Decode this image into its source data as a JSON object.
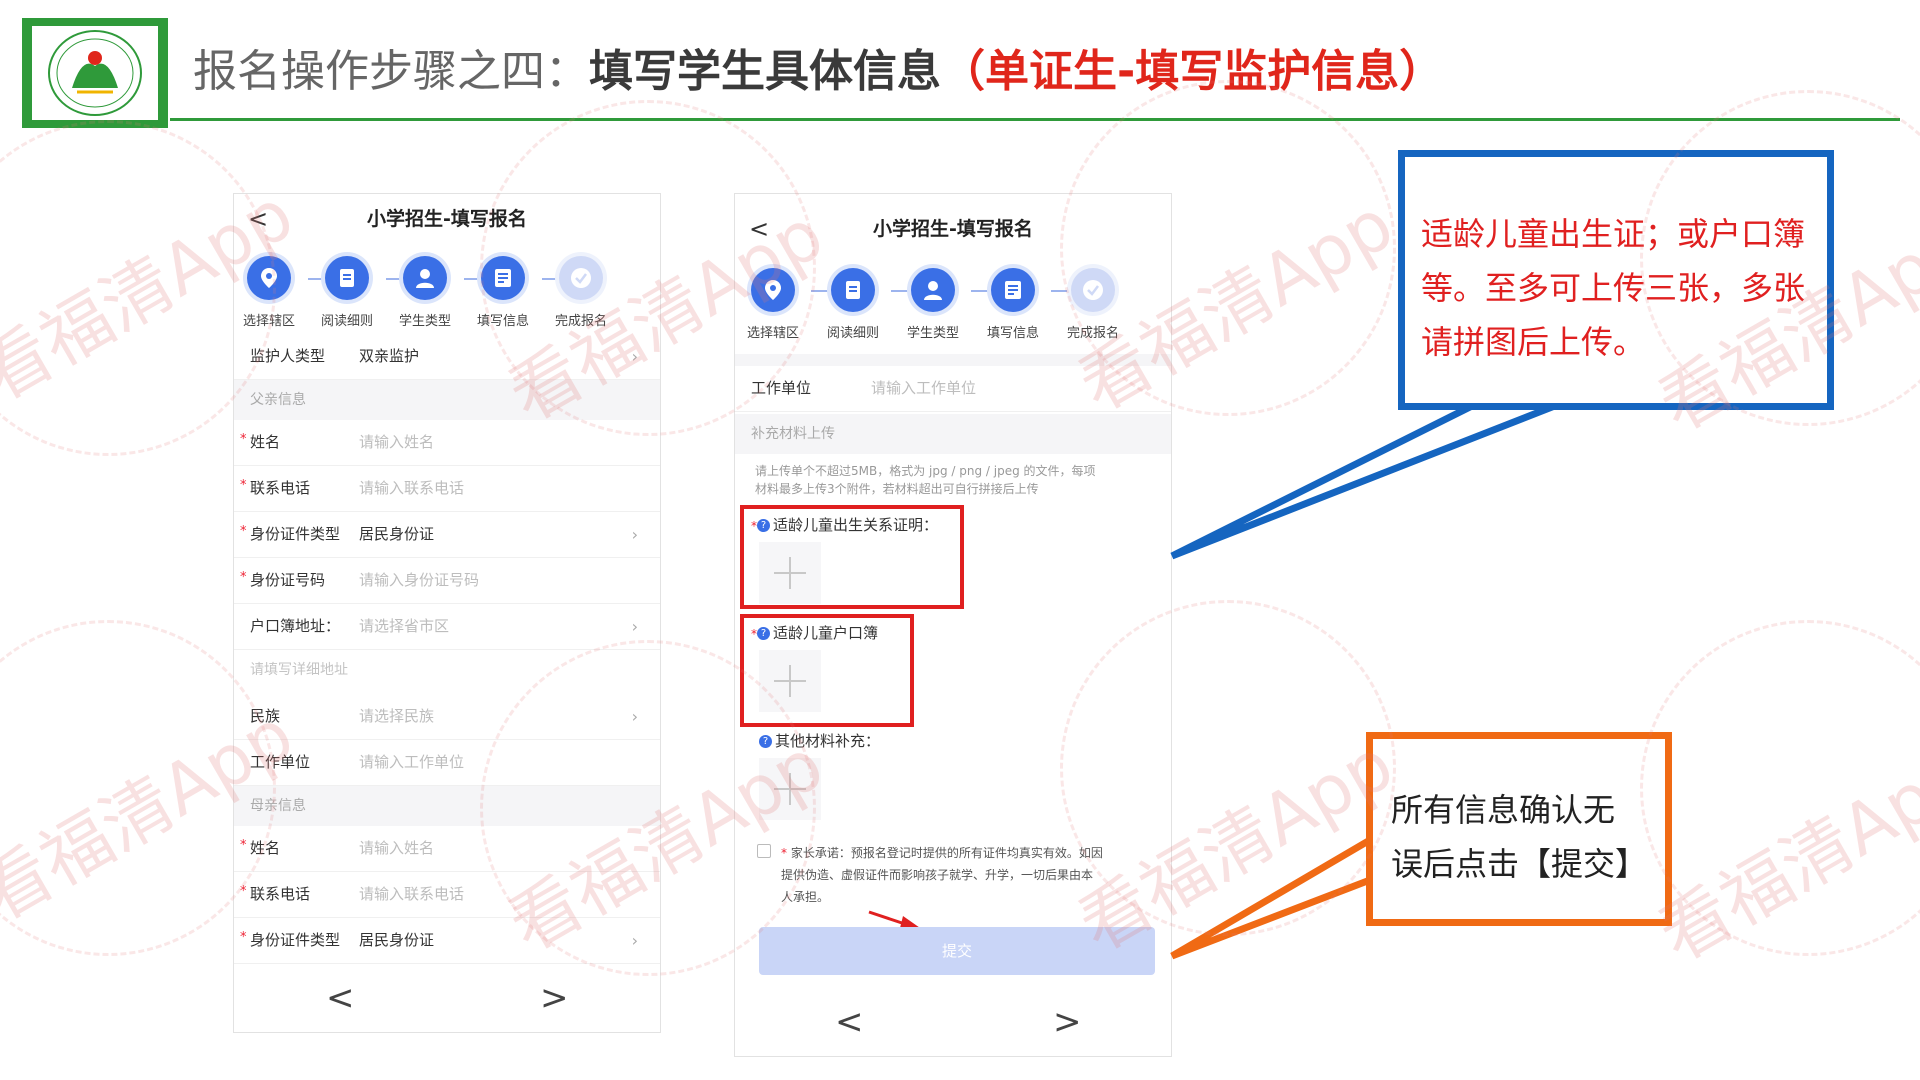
{
  "header": {
    "title_plain": "报名操作步骤之四：",
    "title_bold": "填写学生具体信息",
    "title_red": "（单证生-填写监护信息）"
  },
  "colors": {
    "brand_green": "#2f9a3a",
    "accent_blue": "#3a6fe6",
    "highlight_red": "#e02020",
    "callout_blue": "#1565c0",
    "callout_orange": "#f06a14"
  },
  "steps": [
    "选择辖区",
    "阅读细则",
    "学生类型",
    "填写信息",
    "完成报名"
  ],
  "left_phone": {
    "title": "小学招生-填写报名",
    "back_icon": "<",
    "guardian_type": {
      "label": "监护人类型",
      "value": "双亲监护"
    },
    "father_section": "父亲信息",
    "father": {
      "name": {
        "label": "姓名",
        "placeholder": "请输入姓名"
      },
      "phone": {
        "label": "联系电话",
        "placeholder": "请输入联系电话"
      },
      "id_type": {
        "label": "身份证件类型",
        "value": "居民身份证"
      },
      "id_no": {
        "label": "身份证号码",
        "placeholder": "请输入身份证号码"
      },
      "hukou": {
        "label": "户口簿地址：",
        "placeholder": "请选择省市区"
      },
      "detail_address": "请填写详细地址",
      "ethnic": {
        "label": "民族",
        "placeholder": "请选择民族"
      },
      "work": {
        "label": "工作单位",
        "placeholder": "请输入工作单位"
      }
    },
    "mother_section": "母亲信息",
    "mother": {
      "name": {
        "label": "姓名",
        "placeholder": "请输入姓名"
      },
      "phone": {
        "label": "联系电话",
        "placeholder": "请输入联系电话"
      },
      "id_type": {
        "label": "身份证件类型",
        "value": "居民身份证"
      }
    },
    "pager": {
      "prev": "<",
      "next": ">"
    }
  },
  "right_phone": {
    "title": "小学招生-填写报名",
    "back_icon": "<",
    "work": {
      "label": "工作单位",
      "placeholder": "请输入工作单位"
    },
    "supplement_section": "补充材料上传",
    "upload_note_1": "请上传单个不超过5MB，格式为 jpg / png / jpeg 的文件，每项",
    "upload_note_2": "材料最多上传3个附件，若材料超出可自行拼接后上传",
    "birth_cert": "适龄儿童出生关系证明：",
    "hukou_book": "适龄儿童户口簿",
    "other": "其他材料补充：",
    "promise_1": "家长承诺：预报名登记时提供的所有证件均真实有效。如因",
    "promise_2": "提供伪造、虚假证件而影响孩子就学、升学，一切后果由本",
    "promise_3": "人承担。",
    "submit": "提交",
    "pager": {
      "prev": "<",
      "next": ">"
    }
  },
  "callouts": {
    "blue": [
      "适龄儿童出生证；或户口簿",
      "等。至多可上传三张，多张",
      "请拼图后上传。"
    ],
    "orange": [
      "所有信息确认无",
      "误后点击【提交】"
    ]
  },
  "watermark": {
    "text": "看福清App"
  }
}
